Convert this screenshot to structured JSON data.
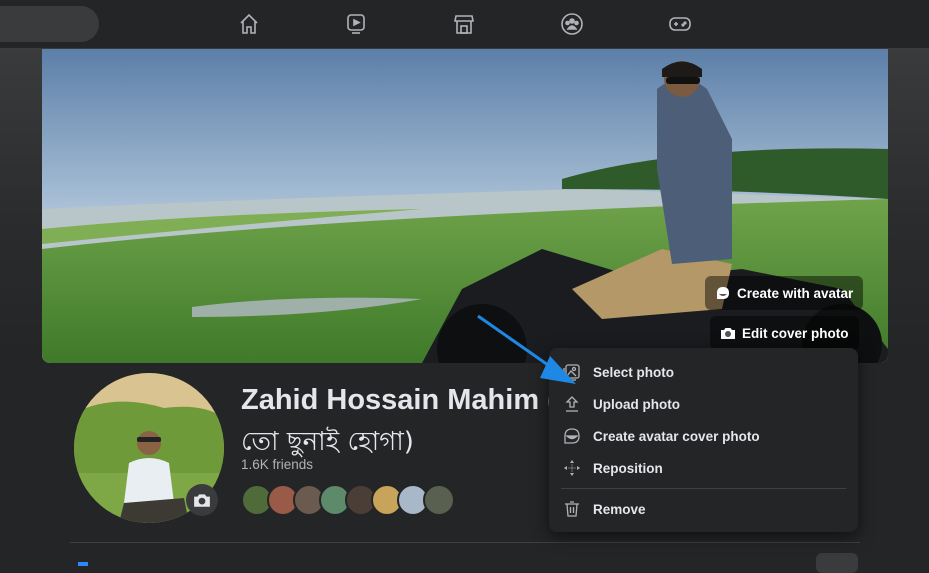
{
  "nav": {
    "icons": [
      "home-icon",
      "watch-icon",
      "marketplace-icon",
      "groups-icon",
      "gaming-icon"
    ]
  },
  "cover": {
    "create_avatar_label": "Create with avatar",
    "edit_cover_label": "Edit cover photo"
  },
  "profile": {
    "name": "Zahid Hossain Mahim (",
    "name_line2": "তো ছুনাই হোগা)",
    "friends": "1.6K friends",
    "friend_avatar_count": 8
  },
  "menu": {
    "items": [
      {
        "label": "Select photo",
        "icon": "photo-icon"
      },
      {
        "label": "Upload photo",
        "icon": "upload-icon"
      },
      {
        "label": "Create avatar cover photo",
        "icon": "avatar-icon"
      },
      {
        "label": "Reposition",
        "icon": "move-icon"
      },
      {
        "label": "Remove",
        "icon": "trash-icon"
      }
    ]
  },
  "colors": {
    "background": "#242526",
    "accent": "#2d88ff",
    "arrow": "#1e88e5"
  }
}
